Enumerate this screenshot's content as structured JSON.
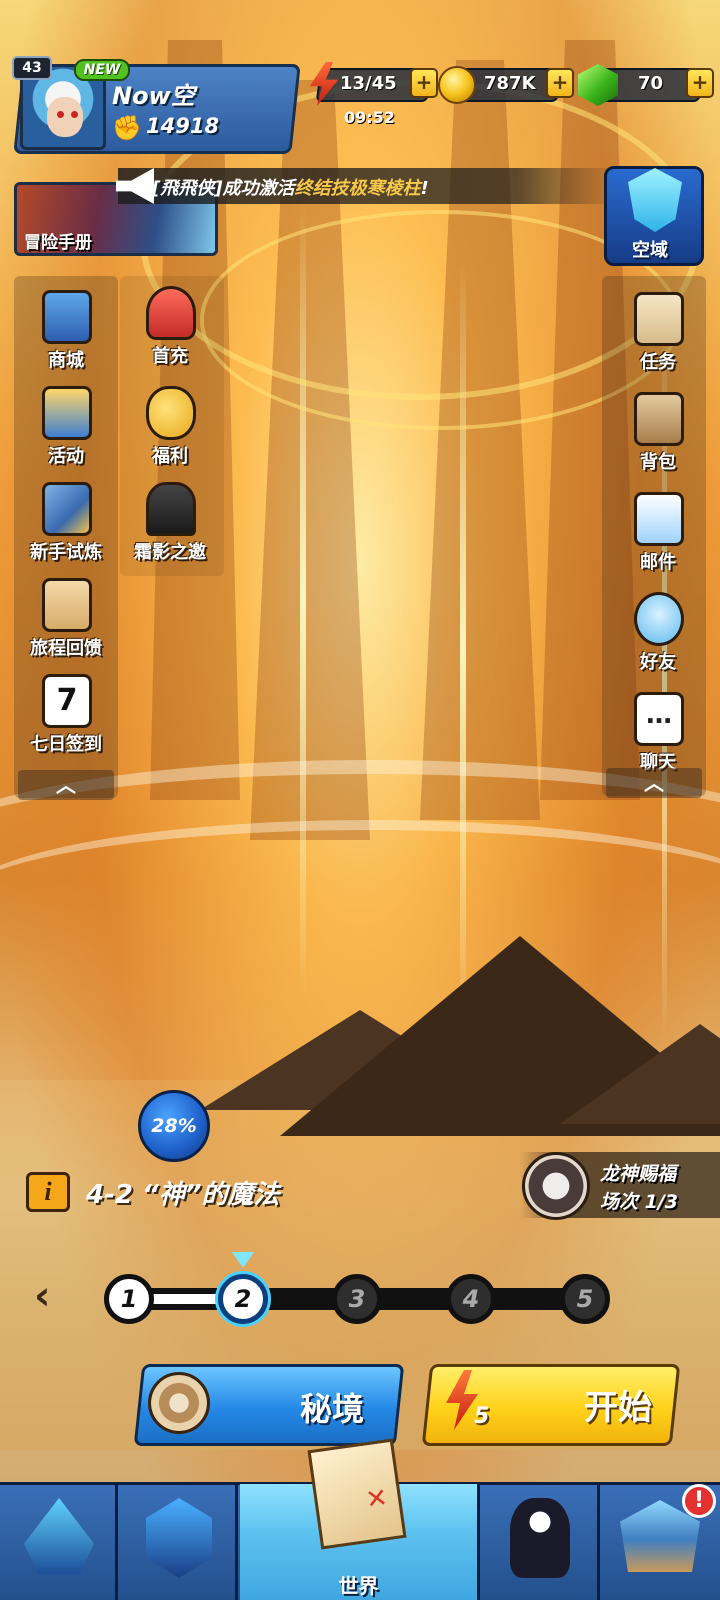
{
  "player": {
    "level": "43",
    "new_badge": "NEW",
    "name": "Now空",
    "power": "14918"
  },
  "resources": {
    "energy": "13/45",
    "energy_timer": "09:52",
    "coins": "787K",
    "gems": "70",
    "plus": "+"
  },
  "announcement": {
    "prefix": "[飛飛侠]成功激活",
    "highlight": "终结技极寒棱柱",
    "suffix": "!"
  },
  "handbook_label": "冒险手册",
  "airspace_label": "空域",
  "left_menu": {
    "items": [
      {
        "label": "商城",
        "icon": "treasure-chest-icon"
      },
      {
        "label": "首充",
        "icon": "first-recharge-monster-icon"
      },
      {
        "label": "活动",
        "icon": "event-chest-icon"
      },
      {
        "label": "福利",
        "icon": "golden-pig-icon"
      },
      {
        "label": "新手试炼",
        "icon": "trial-shield-icon"
      },
      {
        "label": "霜影之邀",
        "icon": "frost-shadow-helmet-icon"
      },
      {
        "label": "旅程回馈",
        "icon": "clipboard-icon"
      },
      {
        "label": "七日签到",
        "icon": "calendar-checkin-icon",
        "day": "7"
      }
    ],
    "collapse": "︿"
  },
  "right_menu": {
    "items": [
      {
        "label": "任务",
        "icon": "scroll-icon"
      },
      {
        "label": "背包",
        "icon": "backpack-icon"
      },
      {
        "label": "邮件",
        "icon": "mail-icon"
      },
      {
        "label": "好友",
        "icon": "friends-icon"
      },
      {
        "label": "聊天",
        "icon": "chat-bubble-icon"
      }
    ],
    "collapse": "︿"
  },
  "stage": {
    "progress": "28%",
    "info_symbol": "i",
    "title": "4-2 “神”的魔法",
    "nodes": [
      "1",
      "2",
      "3",
      "4",
      "5"
    ],
    "current_node": 2,
    "prev_arrow": "‹"
  },
  "blessing": {
    "line1": "龙神赐福",
    "line2": "场次 1/3"
  },
  "actions": {
    "secret_label": "秘境",
    "start_label": "开始",
    "start_cost": "5"
  },
  "bottom_nav": {
    "tabs": [
      {
        "label": "",
        "icon": "hero-crest-icon"
      },
      {
        "label": "",
        "icon": "guild-emblem-icon"
      },
      {
        "label": "世界",
        "icon": "treasure-map-icon"
      },
      {
        "label": "",
        "icon": "character-icon"
      },
      {
        "label": "",
        "icon": "shop-building-icon"
      }
    ],
    "alert": "!"
  },
  "colors": {
    "accent_blue": "#2489e6",
    "accent_yellow": "#ffd21a",
    "highlight_text": "#f6c84a",
    "alert_red": "#e53030"
  }
}
